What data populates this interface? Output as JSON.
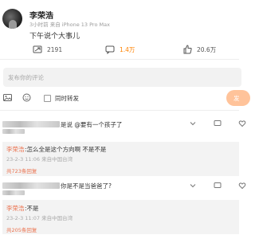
{
  "post": {
    "author": "李荣浩",
    "meta": "3小时前 来自 iPhone 13 Pro Max",
    "text": "下午说个大事儿"
  },
  "actions": {
    "repost_count": "2191",
    "comment_count": "1.4万",
    "like_count": "20.6万"
  },
  "composer": {
    "placeholder": "发布你的评论",
    "repost_toggle_label": "同时转发",
    "send_label": "发"
  },
  "comments": [
    {
      "text": "是说 @要有一个孩子了",
      "reply_user": "李荣浩",
      "reply_text": ":怎么全是这个方向啊 不是不是",
      "reply_meta": "23-2-3 11:06 来自中国台湾",
      "reply_count": "共723条回复"
    },
    {
      "text": "你是不是当爸爸了?",
      "reply_user": "李荣浩",
      "reply_text": ":不是",
      "reply_meta": "23-2-3 11:07 来自中国台湾",
      "reply_count": "共205条回复"
    }
  ],
  "colors": {
    "accent": "#ff8200",
    "reply_name": "#eb7350",
    "send_button": "#ffc39a"
  },
  "icons": [
    "repost-icon",
    "comment-icon",
    "like-icon",
    "image-icon",
    "emoji-icon",
    "chevron-icon",
    "heart-icon"
  ]
}
